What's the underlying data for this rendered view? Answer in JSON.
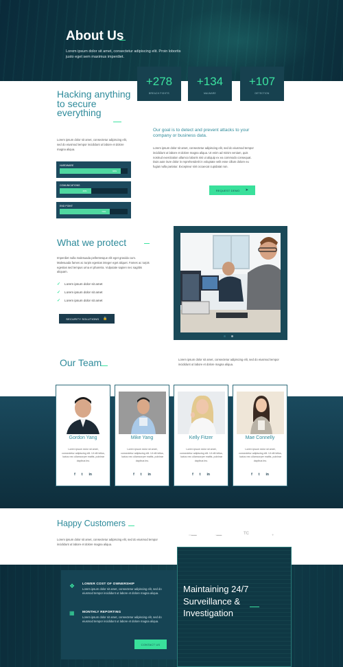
{
  "hero": {
    "title": "About Us",
    "subtitle": "Lorem ipsum dolor sit amet, consectetur adipiscing elit. Proin lobortis justo eget sem maximus imperdiet."
  },
  "stats": [
    {
      "value": "+278",
      "label": "BREACH FIGHTS"
    },
    {
      "value": "+134",
      "label": "MALWARE"
    },
    {
      "value": "+107",
      "label": "DETECTION"
    }
  ],
  "hacking": {
    "title": "Hacking anything to secure everything",
    "text": "Lorem ipsum dolor sit amet, consectetur adipiscing elit, sed do eiusmod tempor incididunt ut labore et dolore magna aliqua.",
    "skills": [
      {
        "name": "HARDWARE",
        "percent_label": "90%",
        "percent": 90
      },
      {
        "name": "COMUNICATIONS",
        "percent_label": "46%",
        "percent": 46
      },
      {
        "name": "END POINT",
        "percent_label": "74%",
        "percent": 74
      }
    ]
  },
  "goal": {
    "title": "Our goal is to detect and prevent attacks to your company or business data.",
    "text": "Lorem ipsum dolor sit amet, consectetur adipiscing elit, sed do eiusmod tempor incididunt ut labore et dolore magna aliqua. Ut enim ad minim veniam, quis nostrud exercitation ullamco laboris nisi ut aliquip ex ea commodo consequat. Duis aute irure dolor in reprehenderit in voluptate velit esse cillum dolore eu fugiat nulla pariatur. Excepteur sint occaecat cupidatat non.",
    "button": "REQUEST DEMO"
  },
  "protect": {
    "title": "What we protect",
    "text": "Imperdiet nulla malesuada pellentesque elit eget gravida cum. Malesuada fames ac turpis egestas integer eget aliquet. Fames ac turpis egestas sed tempus urna et pharetra. Vulputate sapien nec sagittis aliquam.",
    "items": [
      "Lorem ipsum dolor sit amet",
      "Lorem ipsum dolor sit amet",
      "Lorem ipsum dolor sit amet"
    ],
    "button": "SECURITY SOLUTIONS"
  },
  "team": {
    "title": "Our Team",
    "text": "Lorem ipsum dolor sit amet, consectetur adipiscing elit, sed do eiusmod tempor incididunt ut labore et dolore magna aliqua.",
    "members": [
      {
        "name": "Gordon Yang",
        "bio": "Lorem ipsum dolor sit amet, consectetur adipiscing elit. Ut elit tellus, luctus nec ullamcorper mattis, pulvinar dapibus leo."
      },
      {
        "name": "Mike Yang",
        "bio": "Lorem ipsum dolor sit amet, consectetur adipiscing elit. Ut elit tellus, luctus nec ullamcorper mattis, pulvinar dapibus leo."
      },
      {
        "name": "Kelly Fitzer",
        "bio": "Lorem ipsum dolor sit amet, consectetur adipiscing elit. Ut elit tellus, luctus nec ullamcorper mattis, pulvinar dapibus leo."
      },
      {
        "name": "Mae Connelly",
        "bio": "Lorem ipsum dolor sit amet, consectetur adipiscing elit. Ut elit tellus, luctus nec ullamcorper mattis, pulvinar dapibus leo."
      }
    ],
    "social": [
      "f",
      "t",
      "in"
    ]
  },
  "customers": {
    "title": "Happy Customers",
    "text": "Lorem ipsum dolor sit amet, consectetur adipiscing elit, sed do eiusmod tempor incididunt ut labore et dolore magna aliqua.",
    "logos": [
      "▭▬▬",
      "◌▬▬",
      "TC",
      "✈"
    ]
  },
  "features": [
    {
      "title": "LOWER COST OF OWNERSHIP",
      "text": "Lorem ipsum dolor sit amet, consectetur adipiscing elit, sed do eiusmod tempor incididunt ut labore et dolore magna aliqua."
    },
    {
      "title": "MONTHLY REPORTING",
      "text": "Lorem ipsum dolor sit amet, consectetur adipiscing elit, sed do eiusmod tempor incididunt ut labore et dolore magna aliqua."
    }
  ],
  "contact_button": "CONTACT US",
  "maintaining": {
    "title": "Maintaining 24/7 Surveillance & Investigation"
  },
  "colors": {
    "accent": "#3be3a0",
    "heading": "#2d8a9a",
    "dark": "#17414f"
  }
}
